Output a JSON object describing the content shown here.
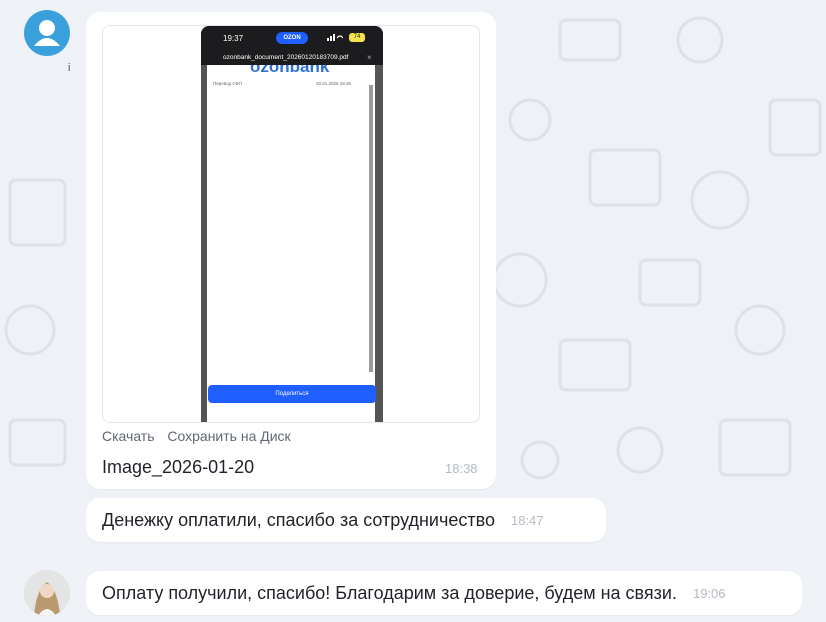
{
  "phone_screenshot": {
    "status_time": "19:37",
    "brand": "OZON",
    "battery": "74",
    "pdf_filename": "ozonbank_document_20260120183709.pdf",
    "pdf_close": "×",
    "pdf_logo": "ozonbank",
    "pdf_transfer_label": "Перевод СБП",
    "pdf_date": "20.01.2026 18:35",
    "share_button": "Поделиться"
  },
  "messages": [
    {
      "type": "file",
      "actions": [
        "Скачать",
        "Сохранить на Диск"
      ],
      "file_name": "Image_2026-01-20",
      "time": "18:38"
    },
    {
      "type": "text",
      "text": "Денежку оплатили, спасибо за сотрудничество",
      "time": "18:47"
    },
    {
      "type": "text",
      "text": "Оплату получили, спасибо! Благодарим за доверие, будем на связи.",
      "time": "19:06"
    }
  ],
  "sender_marker": "i",
  "icons": [
    "default-avatar-icon",
    "user-photo-avatar",
    "wifi-icon",
    "signal-icon",
    "battery-icon",
    "close-icon"
  ],
  "colors": {
    "background": "#eef1f5",
    "bubble": "#ffffff",
    "avatar_default": "#3aa0dc",
    "accent_blue": "#1f5eff",
    "time_text": "#b4bac2"
  }
}
